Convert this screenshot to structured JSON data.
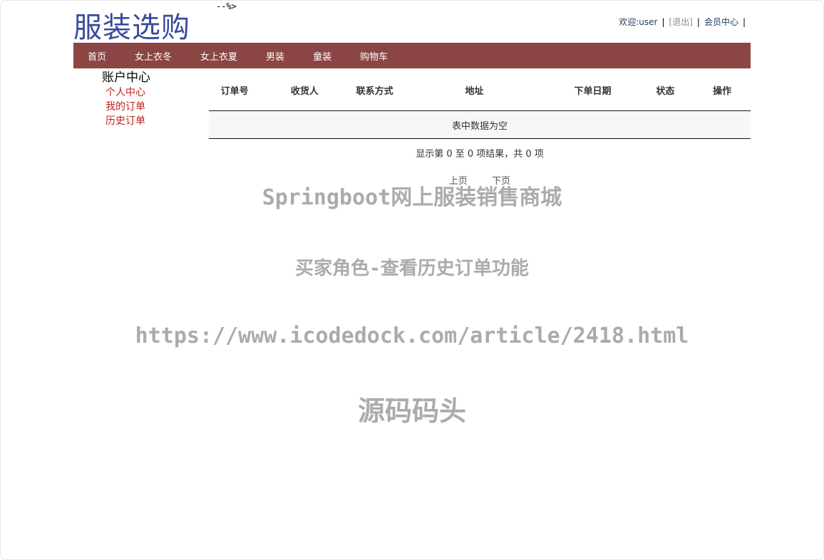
{
  "stray_text": "--%>",
  "logo": "服装选购",
  "topbar": {
    "welcome": "欢迎:user",
    "logout": "[退出]",
    "member_center": "会员中心"
  },
  "nav": [
    "首页",
    "女上衣冬",
    "女上衣夏",
    "男装",
    "童装",
    "购物车"
  ],
  "sidebar": {
    "title": "账户中心",
    "links": [
      "个人中心",
      "我的订单",
      "历史订单"
    ]
  },
  "table": {
    "headers": [
      "订单号",
      "收货人",
      "联系方式",
      "地址",
      "下单日期",
      "状态",
      "操作"
    ],
    "empty_text": "表中数据为空"
  },
  "info_text": "显示第 0 至 0 项结果，共 0 项",
  "pager": {
    "prev": "上页",
    "next": "下页"
  },
  "watermarks": {
    "line1": "Springboot网上服装销售商城",
    "line2": "买家角色-查看历史订单功能",
    "line3": "https://www.icodedock.com/article/2418.html",
    "line4": "源码码头"
  },
  "colors": {
    "nav_bg": "#8b4544",
    "sidebar_link": "#c0211f",
    "logo": "#3a4a9c"
  }
}
